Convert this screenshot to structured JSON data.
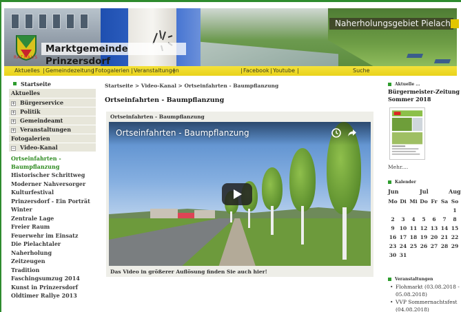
{
  "header": {
    "banner_tag": "Naherholungsgebiet Pielach",
    "site_title": "Marktgemeinde Prinzersdorf",
    "crest_caption": "RATHAUS"
  },
  "nav": {
    "items": [
      "Aktuelles",
      "Gemeindezeitung",
      "Fotogalerien",
      "Veranstaltungen"
    ],
    "social": [
      "Facebook",
      "Youtube"
    ],
    "search": "Suche"
  },
  "sidebar": {
    "home": "Startseite",
    "aktuelles": "Aktuelles",
    "groups": [
      "Bürgerservice",
      "Politik",
      "Gemeindeamt",
      "Veranstaltungen"
    ],
    "fotogalerien": "Fotogalerien",
    "video_kanal": "Video-Kanal",
    "active": "Ortseinfahrten - Baumpflanzung",
    "items": [
      "Historischer Schrittweg",
      "Moderner Nahversorger",
      "Kulturfestival",
      "Prinzersdorf - Ein Porträt",
      "Winter",
      "Zentrale Lage",
      "Freier Raum",
      "Feuerwehr im Einsatz",
      "Die Pielachtaler",
      "Naherholung",
      "Zeitzeugen",
      "Tradition",
      "Faschingsumzug 2014",
      "Kunst in Prinzersdorf",
      "Oldtimer Rallye 2013"
    ]
  },
  "main": {
    "breadcrumb": "Startseite > Video-Kanal > Ortseinfahrten - Baumpflanzung",
    "title": "Ortseinfahrten - Baumpflanzung",
    "box_title": "Ortseinfahrten - Baumpflanzung",
    "video_title": "Ortseinfahrten - Baumpflanzung",
    "note": "Das Video in größerer Auflösung finden Sie auch hier!"
  },
  "right": {
    "news_head": "Aktuelle ...",
    "news_title": "Bürgermeister-Zeitung Sommer 2018",
    "more": "Mehr....",
    "cal_head": "Kalender",
    "months": [
      "Jun",
      "Jul",
      "Aug"
    ],
    "weekdays": [
      "Mo",
      "Di",
      "Mi",
      "Do",
      "Fr",
      "Sa",
      "So"
    ],
    "weeks": [
      [
        "",
        "",
        "",
        "",
        "",
        "",
        "1"
      ],
      [
        "2",
        "3",
        "4",
        "5",
        "6",
        "7",
        "8"
      ],
      [
        "9",
        "10",
        "11",
        "12",
        "13",
        "14",
        "15"
      ],
      [
        "16",
        "17",
        "18",
        "19",
        "20",
        "21",
        "22"
      ],
      [
        "23",
        "24",
        "25",
        "26",
        "27",
        "28",
        "29"
      ],
      [
        "30",
        "31",
        "",
        "",
        "",
        "",
        ""
      ]
    ],
    "events_head": "Veranstaltungen",
    "events": [
      "Flohmarkt (03.08.2018 - 05.08.2018)",
      "VVP Sommernachtsfest (04.08.2018)"
    ]
  }
}
